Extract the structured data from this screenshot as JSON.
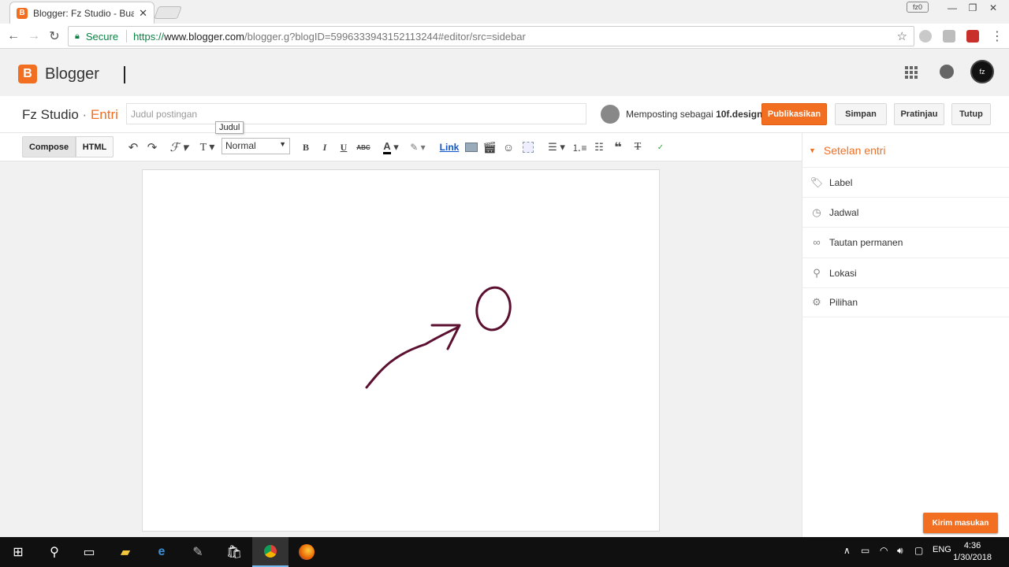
{
  "browser": {
    "tab_title": "Blogger: Fz Studio - Buat",
    "tab_favicon_letter": "B",
    "zoom_badge": "fz0",
    "secure_label": "Secure",
    "url_scheme": "https://",
    "url_host": "www.blogger.com",
    "url_path": "/blogger.g?blogID=5996333943152113244#editor/src=sidebar"
  },
  "header": {
    "logo_letter": "B",
    "app_name": "Blogger",
    "avatar_text": "fz"
  },
  "post": {
    "blog_name": "Fz Studio",
    "separator": "·",
    "section": "Entri",
    "title_placeholder": "Judul postingan",
    "title_value": "",
    "tooltip": "Judul",
    "posting_as_prefix": "Memposting sebagai",
    "posting_as_user": "10f.design",
    "buttons": {
      "publish": "Publikasikan",
      "save": "Simpan",
      "preview": "Pratinjau",
      "close": "Tutup"
    }
  },
  "editor_toolbar": {
    "compose": "Compose",
    "html": "HTML",
    "format_select": "Normal",
    "bold": "B",
    "italic": "I",
    "underline": "U",
    "strike": "ABC",
    "link": "Link",
    "icons": [
      "undo-icon",
      "redo-icon",
      "font-icon",
      "font-size-icon",
      "bold-icon",
      "italic-icon",
      "underline-icon",
      "strikethrough-icon",
      "text-color-icon",
      "highlight-icon",
      "image-icon",
      "video-icon",
      "emoji-icon",
      "jump-break-icon",
      "align-icon",
      "numbered-list-icon",
      "bullet-list-icon",
      "quote-icon",
      "clear-format-icon",
      "spellcheck-icon"
    ]
  },
  "sidebar": {
    "heading": "Setelan entri",
    "items": [
      {
        "label": "Label",
        "icon": "tag-icon"
      },
      {
        "label": "Jadwal",
        "icon": "clock-icon"
      },
      {
        "label": "Tautan permanen",
        "icon": "link-icon"
      },
      {
        "label": "Lokasi",
        "icon": "location-pin-icon"
      },
      {
        "label": "Pilihan",
        "icon": "gear-icon"
      }
    ]
  },
  "feedback_button": "Kirim masukan",
  "taskbar": {
    "language": "ENG",
    "time": "4:36",
    "date": "1/30/2018"
  },
  "colors": {
    "accent": "#f26e21",
    "annotation": "#5c1030"
  }
}
